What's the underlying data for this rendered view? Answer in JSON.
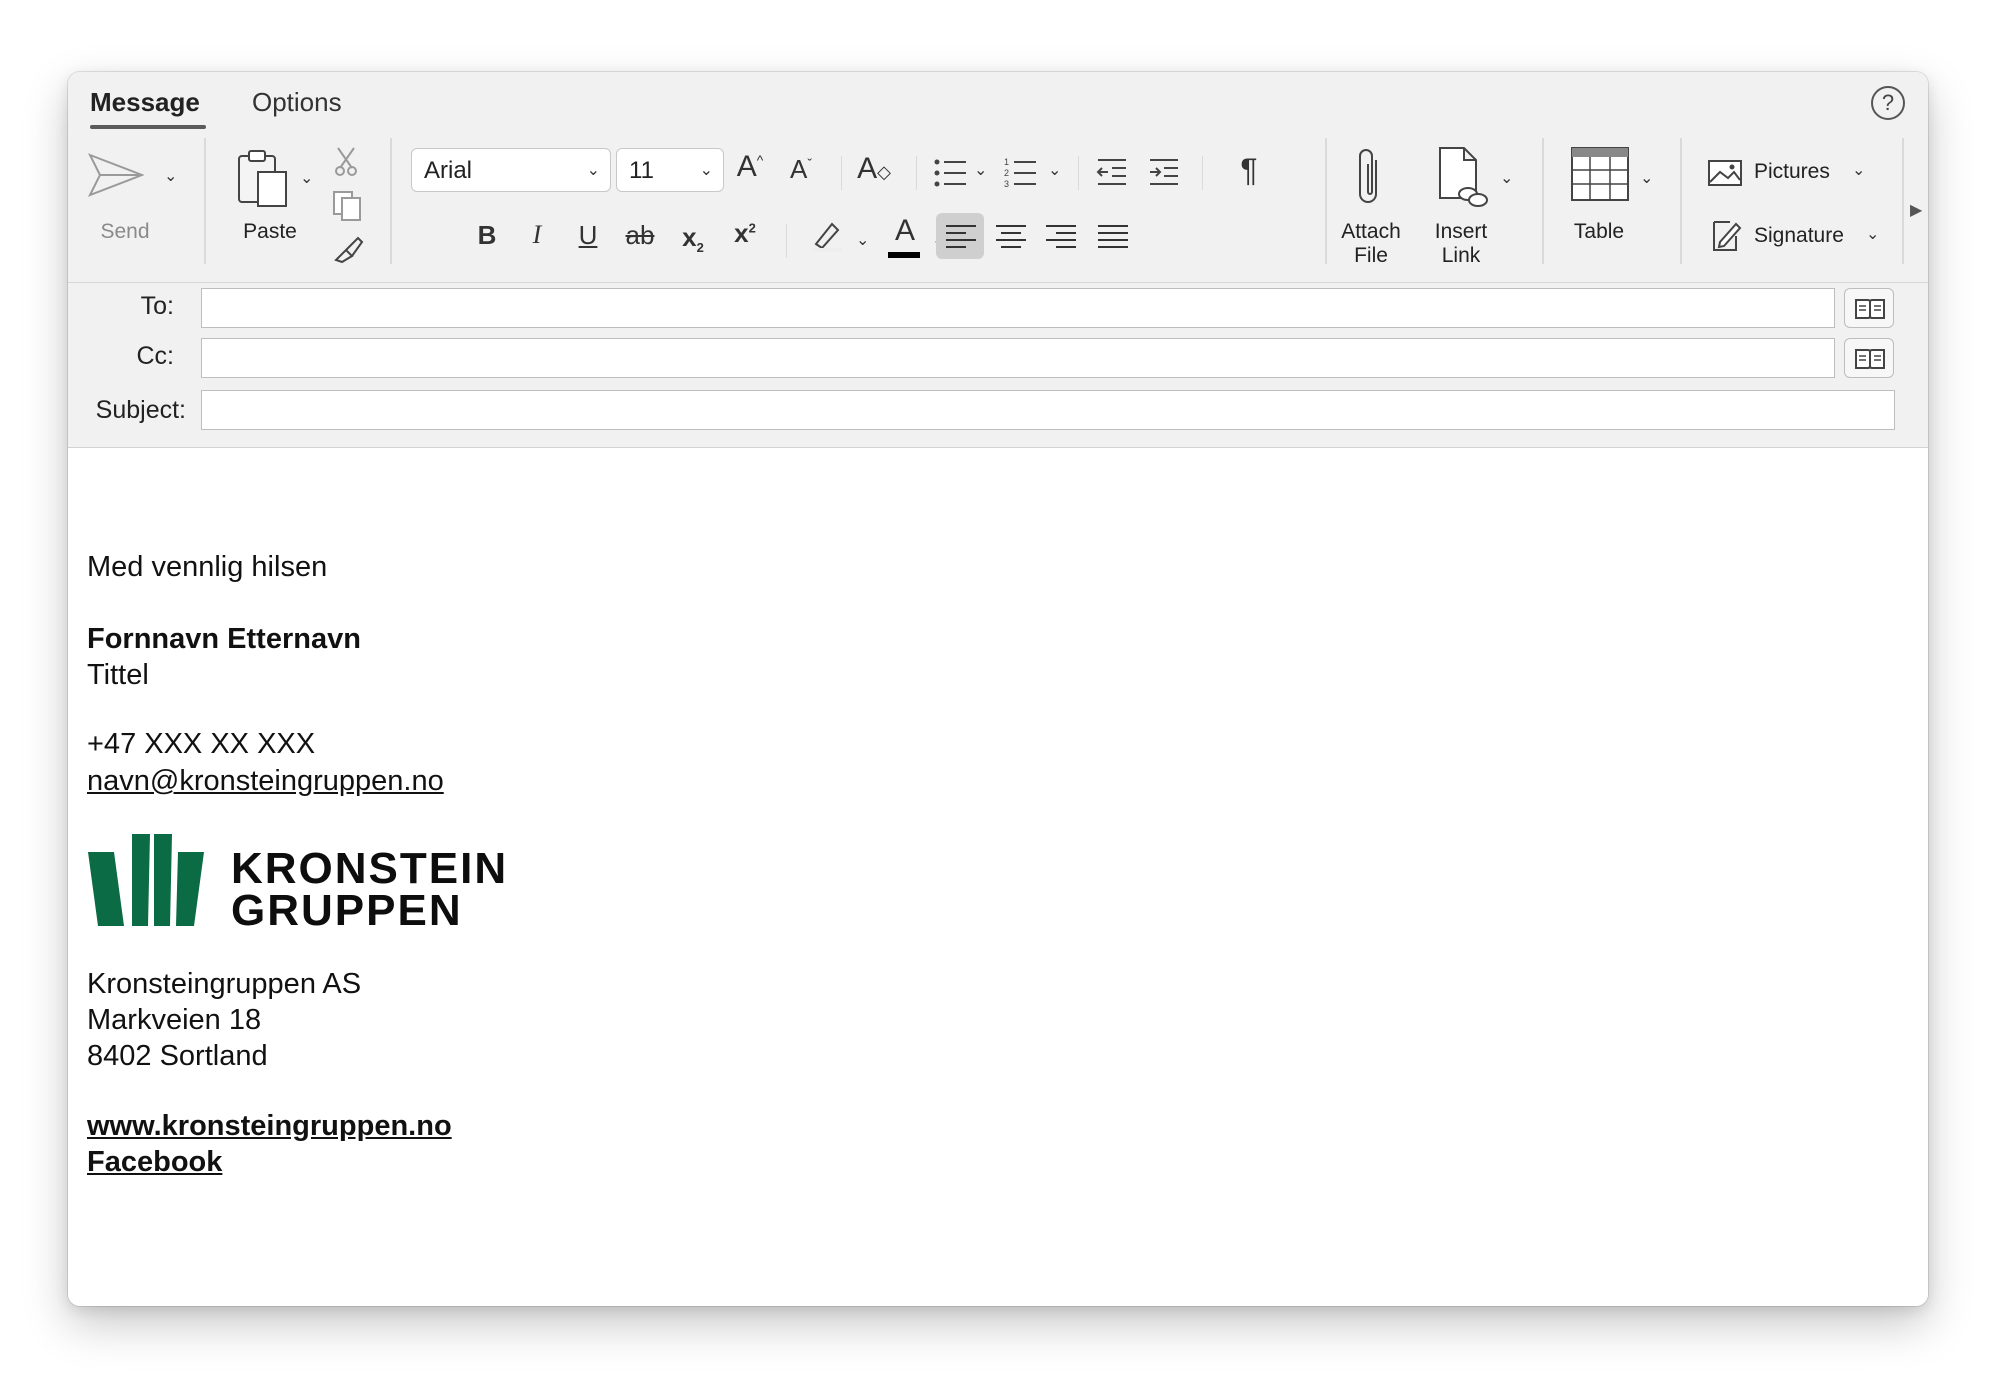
{
  "tabs": [
    {
      "label": "Message",
      "active": true
    },
    {
      "label": "Options",
      "active": false
    }
  ],
  "toolbar": {
    "send_label": "Send",
    "paste_label": "Paste",
    "font_family": "Arial",
    "font_size": "11",
    "attach_label_1": "Attach",
    "attach_label_2": "File",
    "insert_label_1": "Insert",
    "insert_label_2": "Link",
    "table_label": "Table",
    "pictures_label": "Pictures",
    "signature_label": "Signature"
  },
  "fields": {
    "to_label": "To:",
    "cc_label": "Cc:",
    "subject_label": "Subject:",
    "to_value": "",
    "cc_value": "",
    "subject_value": ""
  },
  "body": {
    "greeting": "Med vennlig hilsen",
    "name": "Fornnavn Etternavn",
    "title": "Tittel",
    "phone": "+47 XXX XX XXX",
    "email": "navn@kronsteingruppen.no",
    "logo_line1": "KRONSTEIN",
    "logo_line2": "GRUPPEN",
    "company": "Kronsteingruppen AS",
    "street": "Markveien 18",
    "city": "8402 Sortland",
    "website": "www.kronsteingruppen.no",
    "facebook": "Facebook"
  },
  "colors": {
    "brand_green": "#0a6b45",
    "font_color_bar": "#000000"
  }
}
